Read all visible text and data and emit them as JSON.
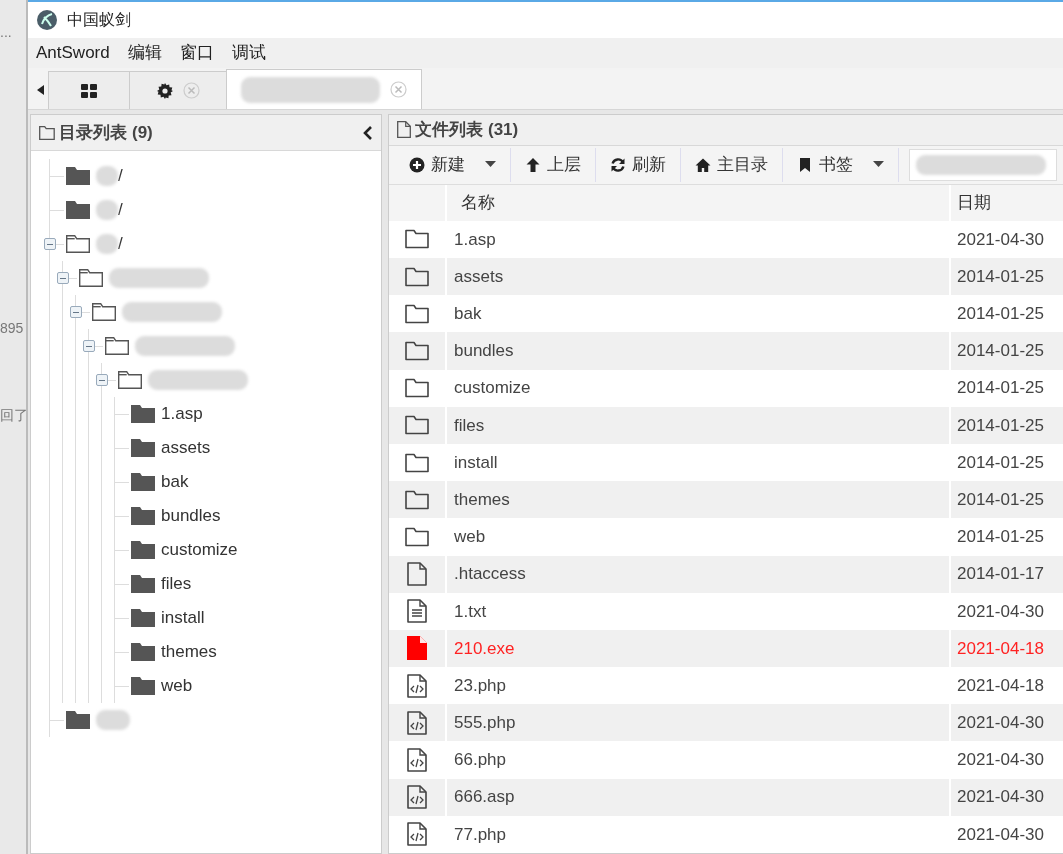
{
  "background_window": {
    "fragments": [
      "...",
      "895",
      "回了"
    ]
  },
  "window": {
    "title": "中国蚁剑"
  },
  "menu": [
    "AntSword",
    "编辑",
    "窗口",
    "调试"
  ],
  "tabs": [
    {
      "kind": "grid",
      "selected": false,
      "closable": false
    },
    {
      "kind": "settings",
      "selected": false,
      "closable": true
    },
    {
      "kind": "redacted",
      "selected": true,
      "closable": true
    }
  ],
  "directory_panel": {
    "title": "目录列表 (9)",
    "tree": [
      {
        "label": "/",
        "redacted": true,
        "expanded": false
      },
      {
        "label": "/",
        "redacted": true,
        "expanded": false
      },
      {
        "label": "/",
        "redacted": true,
        "expanded": true,
        "children": [
          {
            "redacted": true,
            "expanded": true,
            "children": [
              {
                "redacted": true,
                "expanded": true,
                "children": [
                  {
                    "redacted": true,
                    "expanded": true,
                    "children": [
                      {
                        "redacted": true,
                        "expanded": true,
                        "children": [
                          {
                            "label": "1.asp",
                            "expanded": false
                          },
                          {
                            "label": "assets",
                            "expanded": false
                          },
                          {
                            "label": "bak",
                            "expanded": false
                          },
                          {
                            "label": "bundles",
                            "expanded": false
                          },
                          {
                            "label": "customize",
                            "expanded": false
                          },
                          {
                            "label": "files",
                            "expanded": false
                          },
                          {
                            "label": "install",
                            "expanded": false
                          },
                          {
                            "label": "themes",
                            "expanded": false
                          },
                          {
                            "label": "web",
                            "expanded": false
                          }
                        ]
                      }
                    ]
                  }
                ]
              }
            ]
          }
        ]
      },
      {
        "redacted": true,
        "expanded": false
      }
    ]
  },
  "file_panel": {
    "title": "文件列表 (31)",
    "toolbar": [
      {
        "kind": "new",
        "label": "新建",
        "dropdown": true
      },
      {
        "kind": "up",
        "label": "上层",
        "dropdown": false
      },
      {
        "kind": "refresh",
        "label": "刷新",
        "dropdown": false
      },
      {
        "kind": "home",
        "label": "主目录",
        "dropdown": false
      },
      {
        "kind": "bookmark",
        "label": "书签",
        "dropdown": true
      }
    ],
    "path_field": {
      "redacted": true
    },
    "columns": [
      "名称",
      "日期"
    ],
    "rows": [
      {
        "kind": "folder",
        "name": "1.asp",
        "date": "2021-04-30"
      },
      {
        "kind": "folder",
        "name": "assets",
        "date": "2014-01-25"
      },
      {
        "kind": "folder",
        "name": "bak",
        "date": "2014-01-25"
      },
      {
        "kind": "folder",
        "name": "bundles",
        "date": "2014-01-25"
      },
      {
        "kind": "folder",
        "name": "customize",
        "date": "2014-01-25"
      },
      {
        "kind": "folder",
        "name": "files",
        "date": "2014-01-25"
      },
      {
        "kind": "folder",
        "name": "install",
        "date": "2014-01-25"
      },
      {
        "kind": "folder",
        "name": "themes",
        "date": "2014-01-25"
      },
      {
        "kind": "folder",
        "name": "web",
        "date": "2014-01-25"
      },
      {
        "kind": "file",
        "name": ".htaccess",
        "date": "2014-01-17"
      },
      {
        "kind": "text",
        "name": "1.txt",
        "date": "2021-04-30"
      },
      {
        "kind": "executable",
        "name": "210.exe",
        "date": "2021-04-18"
      },
      {
        "kind": "code",
        "name": "23.php",
        "date": "2021-04-18"
      },
      {
        "kind": "code",
        "name": "555.php",
        "date": "2021-04-30"
      },
      {
        "kind": "code",
        "name": "66.php",
        "date": "2021-04-30"
      },
      {
        "kind": "code",
        "name": "666.asp",
        "date": "2021-04-30"
      },
      {
        "kind": "code",
        "name": "77.php",
        "date": "2021-04-30"
      }
    ]
  }
}
